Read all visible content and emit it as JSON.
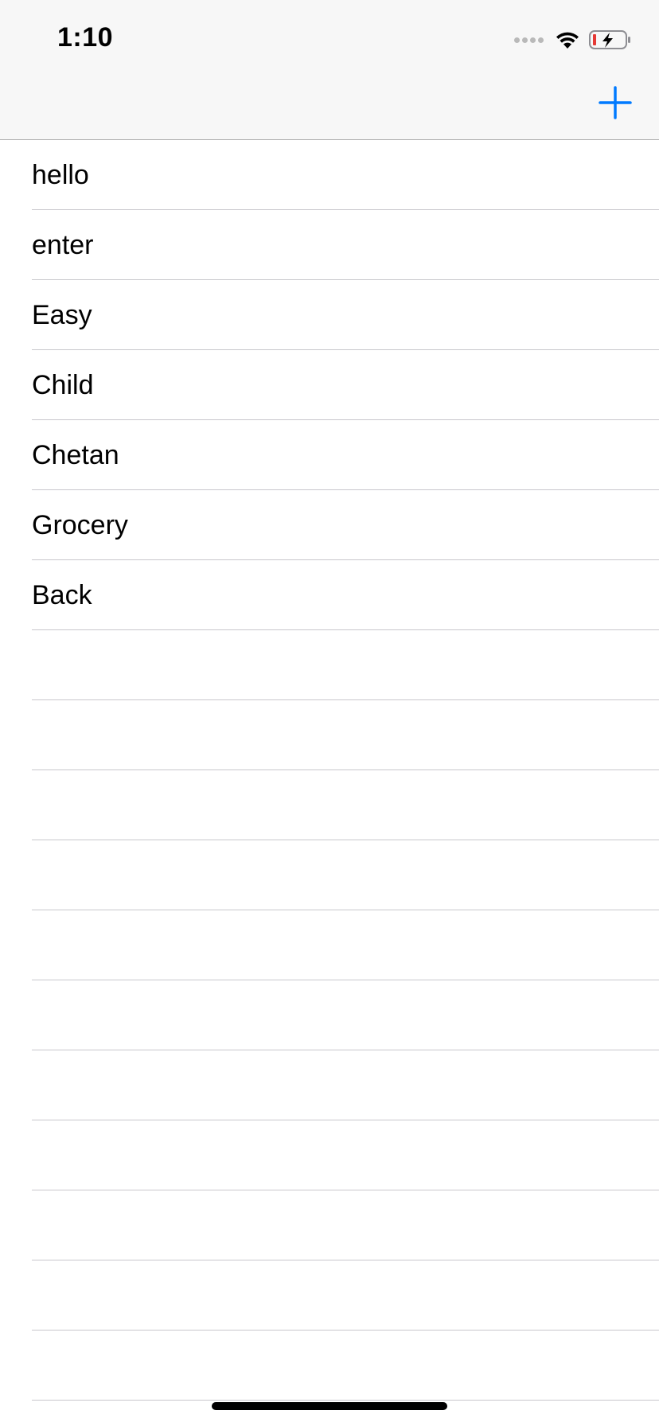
{
  "status_bar": {
    "time": "1:10",
    "icons": [
      "cellular-signal-icon",
      "wifi-icon",
      "battery-charging-icon"
    ]
  },
  "nav_bar": {
    "add_icon": "plus-icon",
    "accent_color": "#007aff"
  },
  "list": {
    "items": [
      "hello",
      "enter",
      "Easy",
      "Child",
      "Chetan",
      "Grocery",
      "Back"
    ],
    "empty_rows": 11
  },
  "colors": {
    "bar_background": "#f7f7f7",
    "separator": "#c8c7cc",
    "battery_low": "#e53935"
  }
}
